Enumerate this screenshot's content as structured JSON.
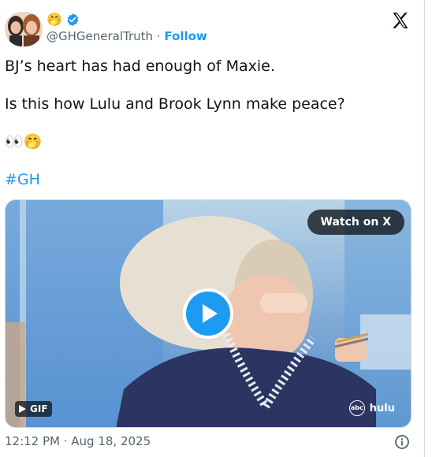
{
  "author": {
    "handle": "@GHGeneralTruth",
    "separator": "·",
    "follow_label": "Follow",
    "badge_emoji": "🤭",
    "verified_color": "#1d9bf0"
  },
  "logo_icon": "x-logo",
  "tweet": {
    "line1": "BJ’s heart has had enough of Maxie.",
    "line2": "Is this how Lulu and Brook Lynn make peace?",
    "line3": "👀🤭",
    "hashtag": "#GH"
  },
  "media": {
    "watch_label": "Watch on X",
    "gif_label": "GIF",
    "network_mark": "abc",
    "network_label": "hulu",
    "play_icon": "play-icon"
  },
  "footer": {
    "timestamp": "12:12 PM · Aug 18, 2025",
    "info_icon": "info-icon"
  },
  "colors": {
    "accent": "#1d9bf0",
    "text": "#0f1419",
    "muted": "#536471"
  }
}
